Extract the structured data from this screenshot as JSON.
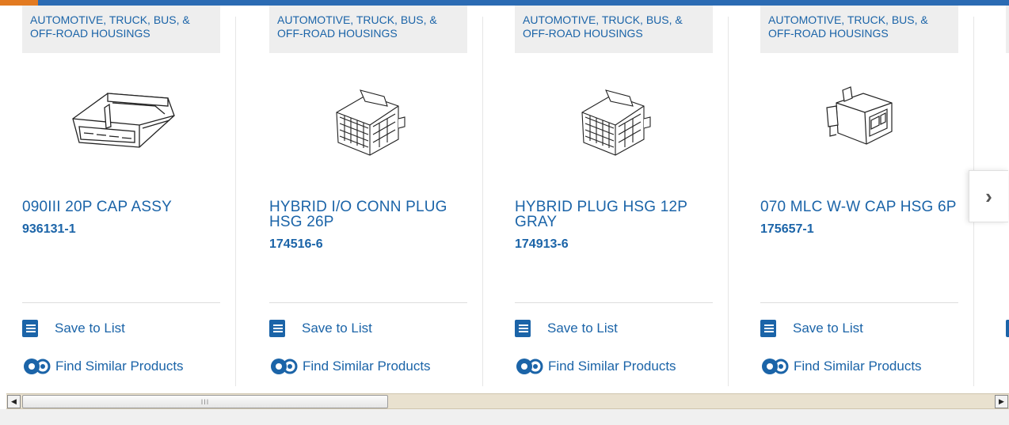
{
  "carousel": {
    "next_label": "›",
    "cards": [
      {
        "category": "AUTOMOTIVE, TRUCK, BUS, & OFF-ROAD HOUSINGS",
        "title": "090III 20P CAP ASSY",
        "part_number": "936131-1",
        "save_label": "Save to List",
        "find_label": "Find Similar Products"
      },
      {
        "category": "AUTOMOTIVE, TRUCK, BUS, & OFF-ROAD HOUSINGS",
        "title": "HYBRID I/O CONN PLUG HSG 26P",
        "part_number": "174516-6",
        "save_label": "Save to List",
        "find_label": "Find Similar Products"
      },
      {
        "category": "AUTOMOTIVE, TRUCK, BUS, & OFF-ROAD HOUSINGS",
        "title": "HYBRID PLUG HSG 12P GRAY",
        "part_number": "174913-6",
        "save_label": "Save to List",
        "find_label": "Find Similar Products"
      },
      {
        "category": "AUTOMOTIVE, TRUCK, BUS, & OFF-ROAD HOUSINGS",
        "title": "070 MLC W-W CAP HSG 6P",
        "part_number": "175657-1",
        "save_label": "Save to List",
        "find_label": "Find Similar Products"
      }
    ]
  },
  "scrollbar": {
    "left_arrow": "◀",
    "right_arrow": "▶",
    "thumb_grip": "III"
  },
  "colors": {
    "link": "#1b64a8",
    "top_bar": "#2b6bb3",
    "top_accent": "#e27a21"
  }
}
